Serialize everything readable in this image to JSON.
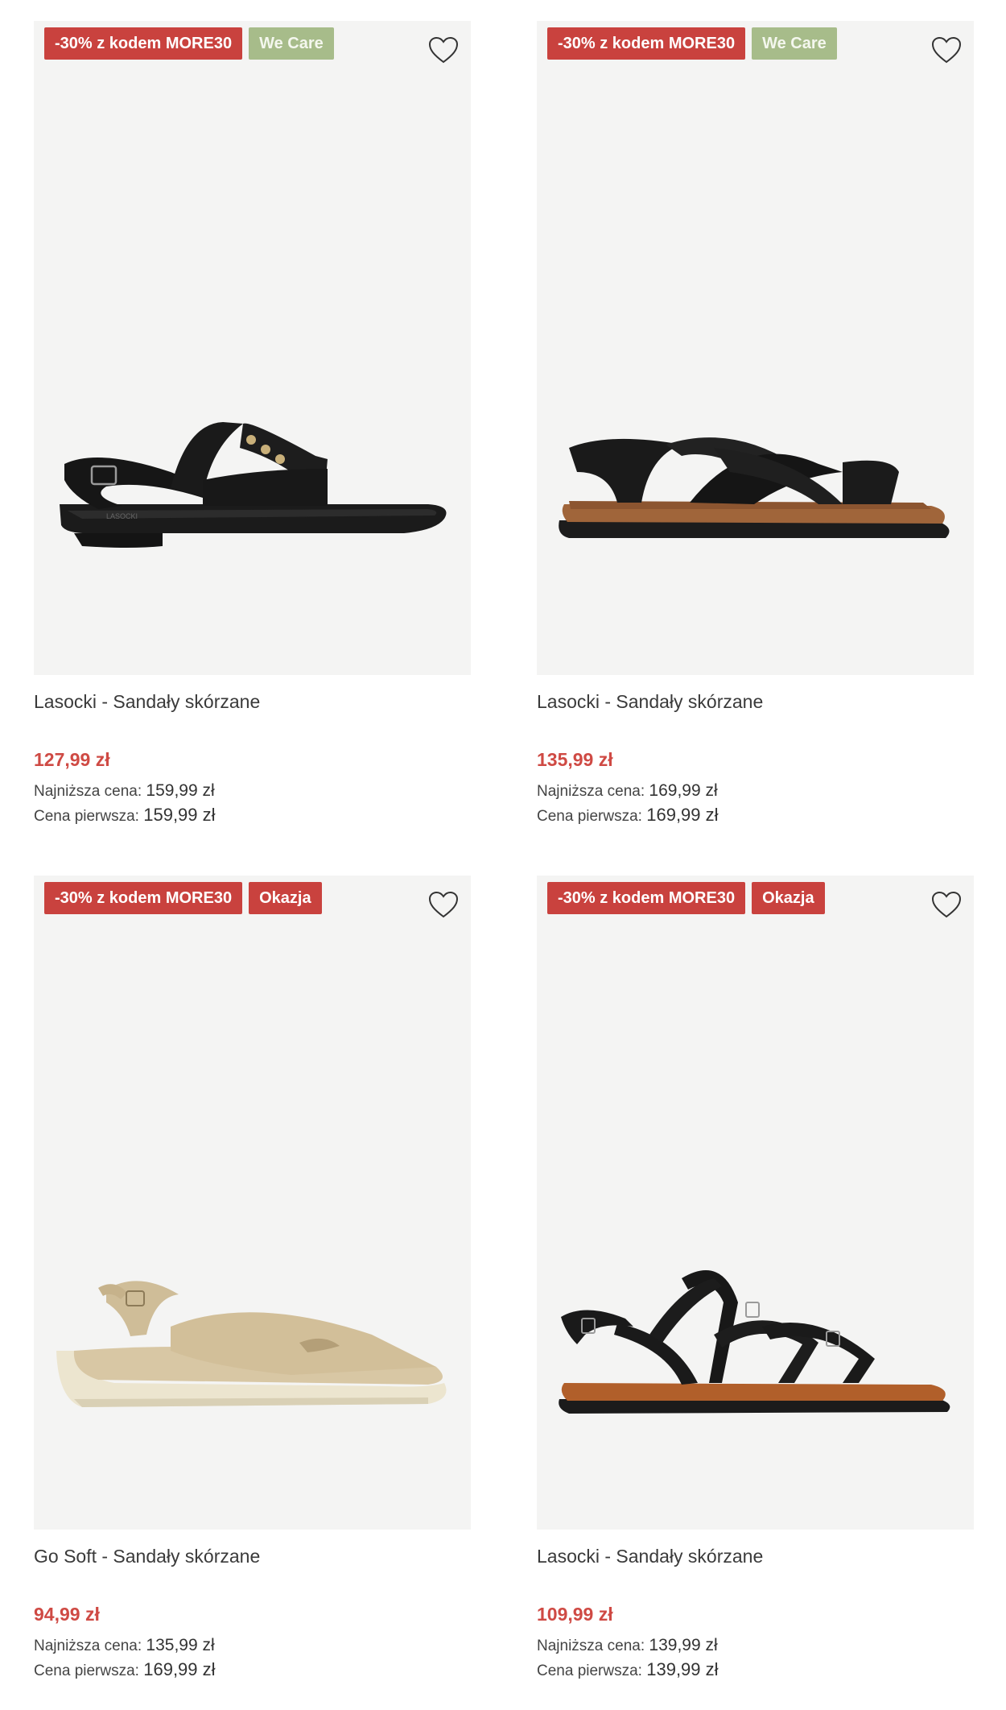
{
  "products": [
    {
      "badges": [
        {
          "text": "-30% z kodem MORE30",
          "kind": "promo"
        },
        {
          "text": "We Care",
          "kind": "care"
        }
      ],
      "name": "Lasocki - Sandały skórzane",
      "price": "127,99 zł",
      "lowest_label": "Najniższa cena:",
      "lowest_value": "159,99 zł",
      "first_label": "Cena pierwsza:",
      "first_value": "159,99 zł",
      "brand_mark": "LASOCKI"
    },
    {
      "badges": [
        {
          "text": "-30% z kodem MORE30",
          "kind": "promo"
        },
        {
          "text": "We Care",
          "kind": "care"
        }
      ],
      "name": "Lasocki - Sandały skórzane",
      "price": "135,99 zł",
      "lowest_label": "Najniższa cena:",
      "lowest_value": "169,99 zł",
      "first_label": "Cena pierwsza:",
      "first_value": "169,99 zł"
    },
    {
      "badges": [
        {
          "text": "-30% z kodem MORE30",
          "kind": "promo"
        },
        {
          "text": "Okazja",
          "kind": "deal"
        }
      ],
      "name": "Go Soft - Sandały skórzane",
      "price": "94,99 zł",
      "lowest_label": "Najniższa cena:",
      "lowest_value": "135,99 zł",
      "first_label": "Cena pierwsza:",
      "first_value": "169,99 zł"
    },
    {
      "badges": [
        {
          "text": "-30% z kodem MORE30",
          "kind": "promo"
        },
        {
          "text": "Okazja",
          "kind": "deal"
        }
      ],
      "name": "Lasocki - Sandały skórzane",
      "price": "109,99 zł",
      "lowest_label": "Najniższa cena:",
      "lowest_value": "139,99 zł",
      "first_label": "Cena pierwsza:",
      "first_value": "139,99 zł"
    }
  ],
  "icons": {
    "wishlist": "heart-outline-icon"
  },
  "colors": {
    "promo_badge": "#c9423e",
    "care_badge": "#a7bc8a",
    "price": "#cf4a44",
    "image_bg": "#f4f4f3"
  }
}
